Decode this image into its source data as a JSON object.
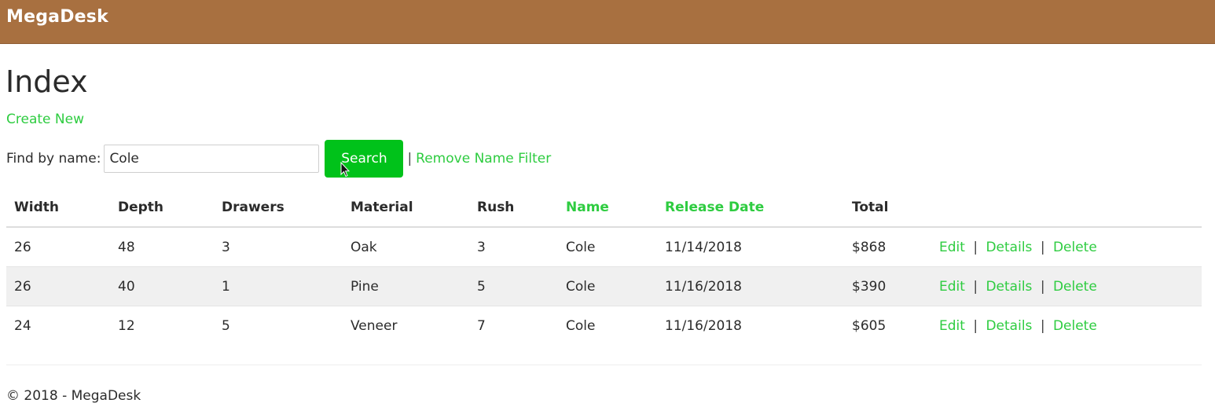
{
  "nav": {
    "brand": "MegaDesk"
  },
  "page": {
    "title": "Index",
    "create_new": "Create New"
  },
  "search": {
    "label": "Find by name:",
    "value": "Cole",
    "button": "Search",
    "separator": "|",
    "remove_filter": "Remove Name Filter"
  },
  "table": {
    "headers": {
      "width": "Width",
      "depth": "Depth",
      "drawers": "Drawers",
      "material": "Material",
      "rush": "Rush",
      "name": "Name",
      "release_date": "Release Date",
      "total": "Total"
    },
    "actions": {
      "edit": "Edit",
      "details": "Details",
      "delete": "Delete",
      "separator": "|"
    },
    "rows": [
      {
        "width": "26",
        "depth": "48",
        "drawers": "3",
        "material": "Oak",
        "rush": "3",
        "name": "Cole",
        "release_date": "11/14/2018",
        "total": "$868"
      },
      {
        "width": "26",
        "depth": "40",
        "drawers": "1",
        "material": "Pine",
        "rush": "5",
        "name": "Cole",
        "release_date": "11/16/2018",
        "total": "$390"
      },
      {
        "width": "24",
        "depth": "12",
        "drawers": "5",
        "material": "Veneer",
        "rush": "7",
        "name": "Cole",
        "release_date": "11/16/2018",
        "total": "$605"
      }
    ]
  },
  "footer": {
    "text": "© 2018 - MegaDesk"
  },
  "colors": {
    "navbar": "#a87040",
    "link": "#2ecc40",
    "button": "#00c21a",
    "stripe": "#f0f0f0"
  },
  "icons": {
    "cursor": "mouse-pointer-icon"
  }
}
